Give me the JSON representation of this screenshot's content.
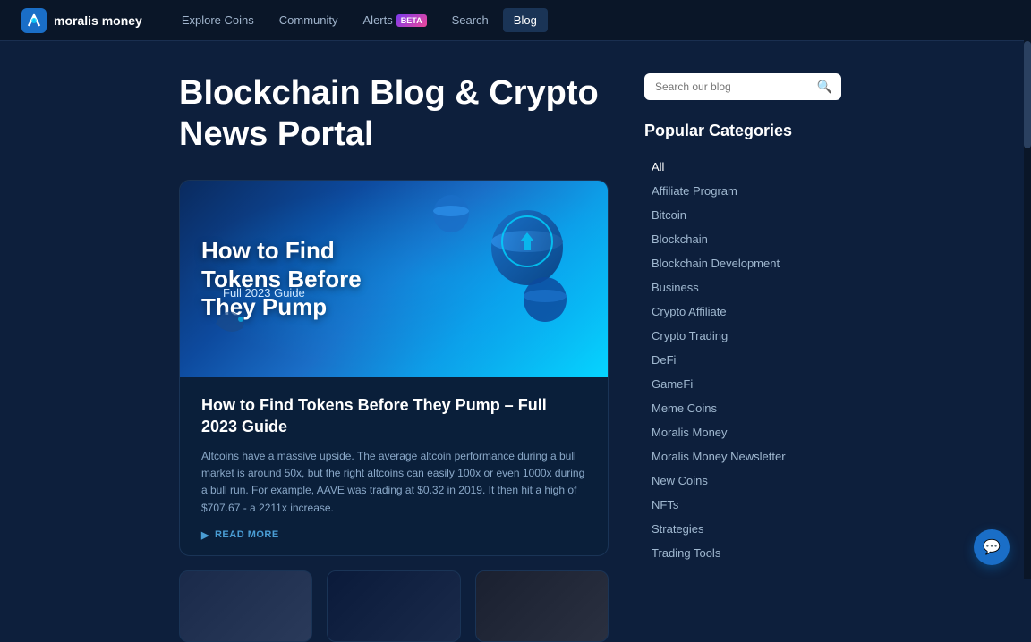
{
  "nav": {
    "logo_text": "moralis money",
    "links": [
      {
        "label": "Explore Coins",
        "active": false
      },
      {
        "label": "Community",
        "active": false
      },
      {
        "label": "Alerts",
        "active": false,
        "badge": "BETA"
      },
      {
        "label": "Search",
        "active": false
      },
      {
        "label": "Blog",
        "active": true
      }
    ]
  },
  "page": {
    "title_line1": "Blockchain Blog & Crypto",
    "title_line2": "News Portal",
    "search_placeholder": "Search our blog"
  },
  "featured": {
    "image_title_line1": "How to Find",
    "image_title_line2": "Tokens Before",
    "image_title_line3": "They Pump",
    "image_subtitle": "Full 2023 Guide",
    "article_title": "How to Find Tokens Before They Pump – Full 2023 Guide",
    "excerpt": "Altcoins have a massive upside. The average altcoin performance during a bull market is around 50x, but the right altcoins can easily 100x or even 1000x during a bull run. For example, AAVE was trading at $0.32 in 2019. It then hit a high of $707.67 - a 2211x increase.",
    "read_more": "READ MORE"
  },
  "categories": {
    "title": "Popular Categories",
    "items": [
      {
        "label": "All"
      },
      {
        "label": "Affiliate Program"
      },
      {
        "label": "Bitcoin"
      },
      {
        "label": "Blockchain"
      },
      {
        "label": "Blockchain Development"
      },
      {
        "label": "Business"
      },
      {
        "label": "Crypto Affiliate"
      },
      {
        "label": "Crypto Trading"
      },
      {
        "label": "DeFi"
      },
      {
        "label": "GameFi"
      },
      {
        "label": "Meme Coins"
      },
      {
        "label": "Moralis Money"
      },
      {
        "label": "Moralis Money Newsletter"
      },
      {
        "label": "New Coins"
      },
      {
        "label": "NFTs"
      },
      {
        "label": "Strategies"
      },
      {
        "label": "Trading Tools"
      }
    ]
  }
}
